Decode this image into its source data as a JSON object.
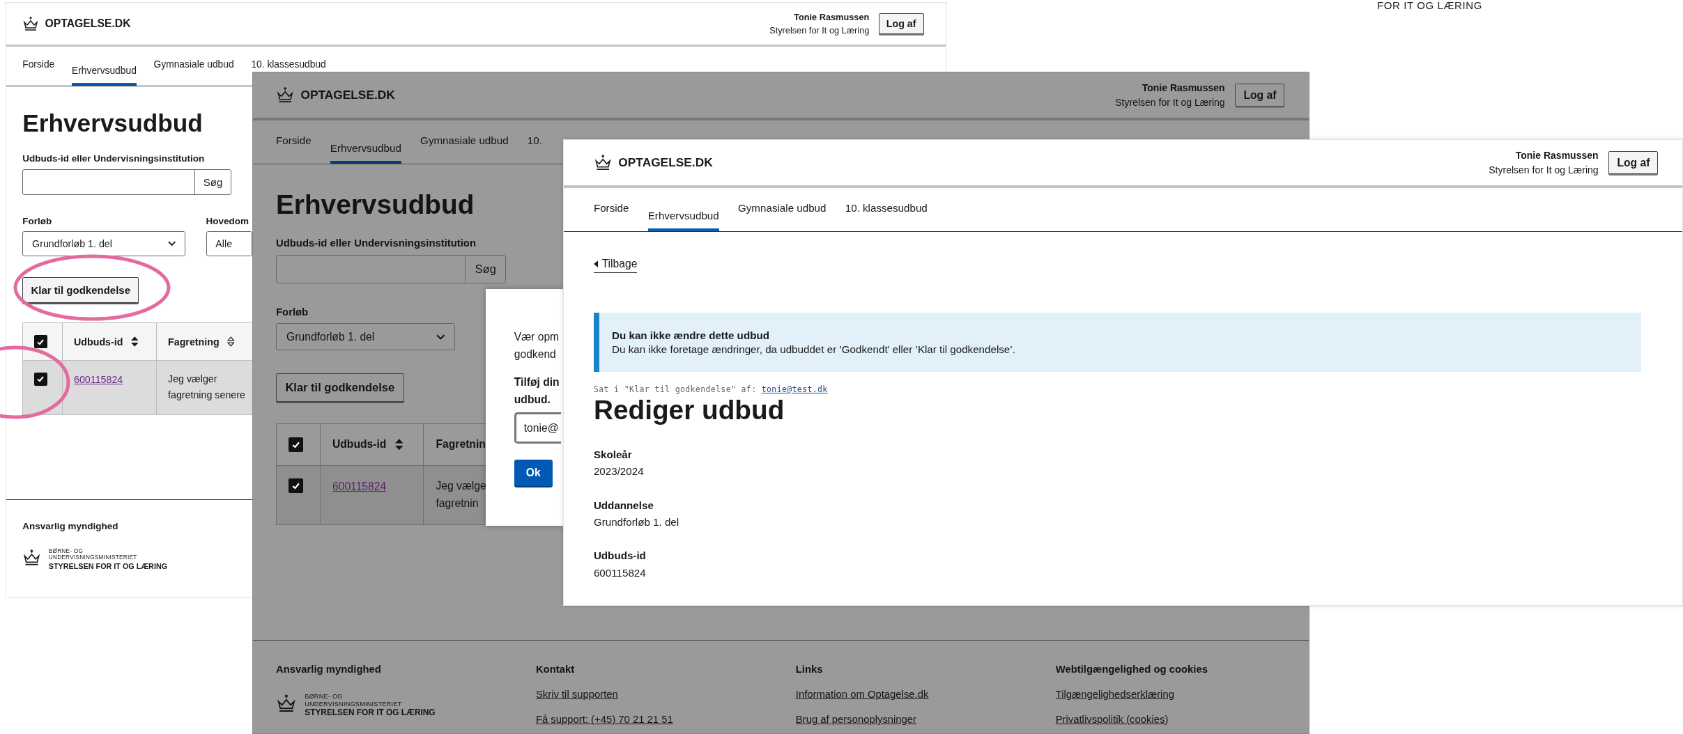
{
  "background_fragment": {
    "text": "FOR IT OG LÆRING"
  },
  "windows": [
    {
      "dimmed": false,
      "header": {
        "logo": "OPTAGELSE.DK",
        "user_name": "Tonie Rasmussen",
        "organization": "Styrelsen for It og Læring",
        "logout": "Log af"
      },
      "nav": [
        {
          "label": "Forside",
          "selected": false
        },
        {
          "label": "Erhvervsudbud",
          "selected": true
        },
        {
          "label": "Gymnasiale udbud",
          "selected": false
        },
        {
          "label": "10. klassesudbud",
          "selected": false
        }
      ],
      "page": {
        "kind": "list",
        "title": "Erhvervsudbud",
        "search_label": "Udbuds-id eller Undervisningsinstitution",
        "search_button": "Søg",
        "filters": [
          {
            "label": "Forløb",
            "value": "Grundforløb 1. del",
            "chevron_visible": true
          },
          {
            "label": "Hovedom",
            "value": "Alle",
            "chevron_visible": false
          }
        ],
        "action_button": "Klar til godkendelse",
        "table": {
          "select_all_checked": true,
          "columns": [
            {
              "label": "Udbuds-id",
              "sorted": true
            },
            {
              "label": "Fagretning",
              "sorted": false
            }
          ],
          "rows": [
            {
              "checked": true,
              "cells": [
                "600115824",
                "Jeg vælger fagretning senere"
              ]
            }
          ]
        }
      },
      "footer": {
        "columns": [
          {
            "kind": "logo",
            "heading": "Ansvarlig myndighed",
            "lines": [
              "BØRNE- OG",
              "UNDERVISNINGSMINISTERIET",
              "STYRELSEN FOR IT OG LÆRING"
            ]
          }
        ]
      }
    },
    {
      "dimmed": true,
      "header": {
        "logo": "OPTAGELSE.DK",
        "user_name": "Tonie Rasmussen",
        "organization": "Styrelsen for It og Læring",
        "logout": "Log af"
      },
      "nav": [
        {
          "label": "Forside",
          "selected": false
        },
        {
          "label": "Erhvervsudbud",
          "selected": true
        },
        {
          "label": "Gymnasiale udbud",
          "selected": false
        },
        {
          "label": "10.",
          "selected": false
        }
      ],
      "page": {
        "kind": "list",
        "title": "Erhvervsudbud",
        "search_label": "Udbuds-id eller Undervisningsinstitution",
        "search_button": "Søg",
        "filters": [
          {
            "label": "Forløb",
            "value": "Grundforløb 1. del",
            "chevron_visible": true
          }
        ],
        "action_button": "Klar til godkendelse",
        "table": {
          "select_all_checked": true,
          "columns": [
            {
              "label": "Udbuds-id",
              "sorted": true
            },
            {
              "label": "Fagretnin"
            }
          ],
          "rows": [
            {
              "checked": true,
              "cells": [
                "600115824",
                "Jeg vælge fagretnin"
              ]
            }
          ]
        }
      },
      "modal": {
        "lines": [
          "Vær opm",
          "godkend"
        ],
        "field_label_lines": [
          "Tilføj din",
          "udbud."
        ],
        "input_value": "tonie@",
        "ok": "Ok"
      },
      "footer": {
        "columns": [
          {
            "kind": "logo",
            "heading": "Ansvarlig myndighed",
            "lines": [
              "BØRNE- OG",
              "UNDERVISNINGSMINISTERIET",
              "STYRELSEN FOR IT OG LÆRING"
            ]
          },
          {
            "kind": "links",
            "heading": "Kontakt",
            "links": [
              "Skriv til supporten",
              "Få support: (+45) 70 21 21 51"
            ]
          },
          {
            "kind": "links",
            "heading": "Links",
            "links": [
              "Information om Optagelse.dk",
              "Brug af personoplysninger"
            ]
          },
          {
            "kind": "links",
            "heading": "Webtilgængelighed og cookies",
            "links": [
              "Tilgængelighedserklæring",
              "Privatlivspolitik (cookies)"
            ]
          }
        ]
      }
    },
    {
      "dimmed": false,
      "header": {
        "logo": "OPTAGELSE.DK",
        "user_name": "Tonie Rasmussen",
        "organization": "Styrelsen for It og Læring",
        "logout": "Log af"
      },
      "nav": [
        {
          "label": "Forside",
          "selected": false
        },
        {
          "label": "Erhvervsudbud",
          "selected": true
        },
        {
          "label": "Gymnasiale udbud",
          "selected": false
        },
        {
          "label": "10. klassesudbud",
          "selected": false
        }
      ],
      "page": {
        "kind": "detail",
        "back_link": "Tilbage",
        "alert": {
          "title": "Du kan ikke ændre dette udbud",
          "text": "Du kan ikke foretage ændringer, da udbuddet er ’Godkendt’ eller ’Klar til godkendelse’."
        },
        "status_text": "Sat i \"Klar til godkendelse\" af:",
        "status_link": "tonie@test.dk",
        "title": "Rediger udbud",
        "fields": [
          {
            "label": "Skoleår",
            "value": "2023/2024"
          },
          {
            "label": "Uddannelse",
            "value": "Grundforløb 1. del"
          },
          {
            "label": "Udbuds-id",
            "value": "600115824"
          }
        ]
      }
    }
  ]
}
